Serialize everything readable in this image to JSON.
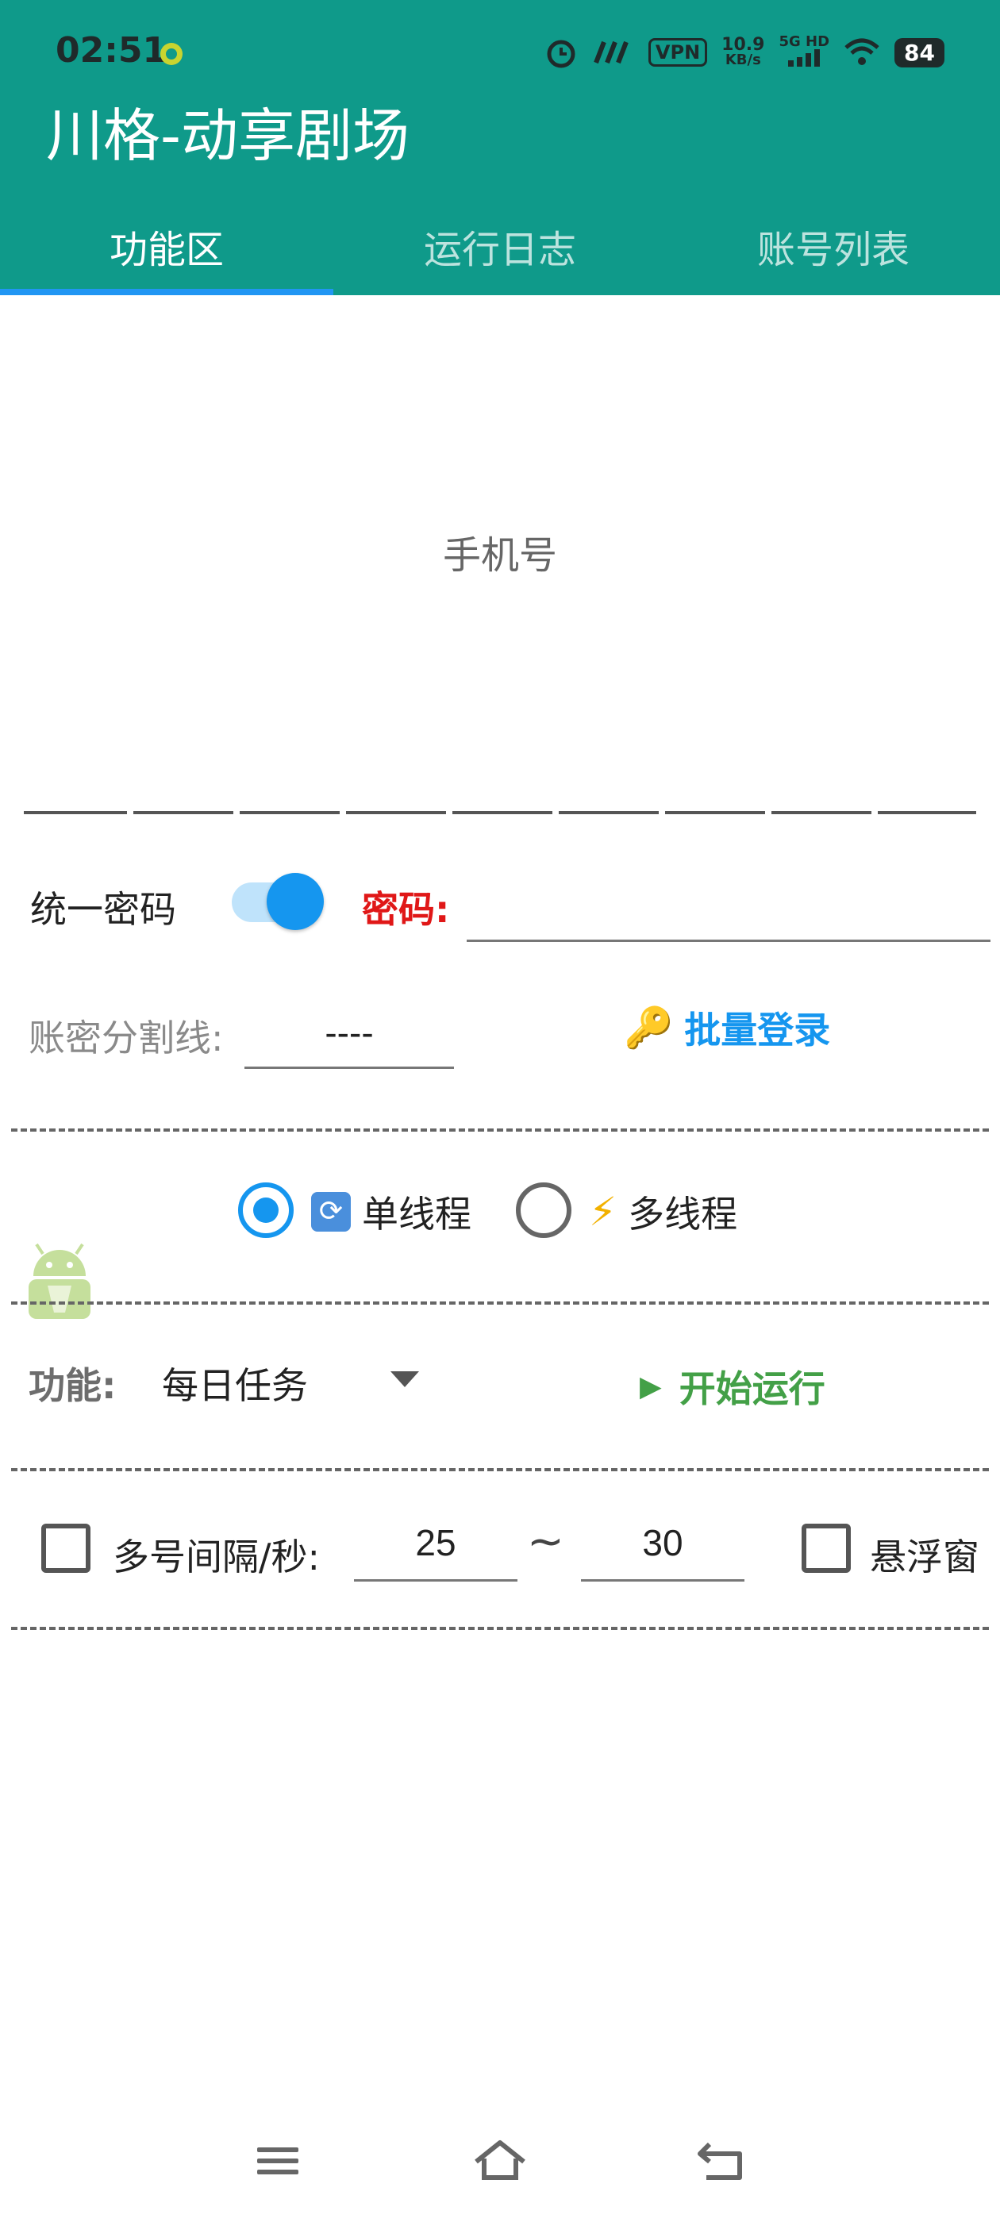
{
  "status_bar": {
    "time": "02:51",
    "speed_value": "10.9",
    "speed_unit": "KB/s",
    "network": "5G HD",
    "vpn": "VPN",
    "battery": "84"
  },
  "app": {
    "title": "川格-动享剧场"
  },
  "tabs": [
    {
      "label": "功能区",
      "active": true
    },
    {
      "label": "运行日志",
      "active": false
    },
    {
      "label": "账号列表",
      "active": false
    }
  ],
  "phone": {
    "placeholder": "手机号"
  },
  "unify_password": {
    "label": "统一密码",
    "enabled": true
  },
  "password": {
    "label": "密码:",
    "value": ""
  },
  "separator": {
    "label": "账密分割线:",
    "value": "----"
  },
  "batch_login": {
    "label": "批量登录"
  },
  "threads": {
    "single": {
      "label": "单线程",
      "selected": true
    },
    "multi": {
      "label": "多线程",
      "selected": false
    }
  },
  "function": {
    "label": "功能:",
    "value": "每日任务"
  },
  "start_run": {
    "label": "开始运行"
  },
  "interval": {
    "label": "多号间隔/秒:",
    "min": "25",
    "tilde": "~",
    "max": "30",
    "checked": false
  },
  "float_window": {
    "label": "悬浮窗",
    "checked": false
  },
  "colors": {
    "header": "#0f9a8a",
    "accent": "#1596ef",
    "password_label": "#e01717",
    "start_green": "#43a047"
  }
}
